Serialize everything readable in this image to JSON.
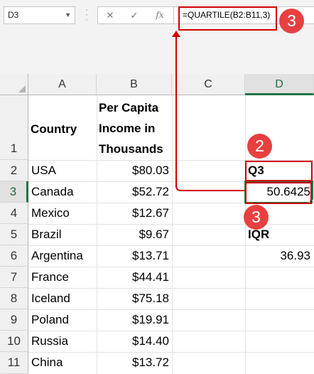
{
  "name_box": "D3",
  "formula_bar": {
    "cancel": "✕",
    "enter": "✓",
    "fx": "fx",
    "formula": "=QUARTILE(B2:B11,3)"
  },
  "columns": [
    "A",
    "B",
    "C",
    "D"
  ],
  "rows": [
    "1",
    "2",
    "3",
    "4",
    "5",
    "6",
    "7",
    "8",
    "9",
    "10",
    "11"
  ],
  "headers": {
    "country": "Country",
    "income_line1": "Per Capita",
    "income_line2": "Income in",
    "income_line3": "Thousands"
  },
  "data": [
    {
      "country": "USA",
      "income": "$80.03"
    },
    {
      "country": "Canada",
      "income": "$52.72"
    },
    {
      "country": "Mexico",
      "income": "$12.67"
    },
    {
      "country": "Brazil",
      "income": "$9.67"
    },
    {
      "country": "Argentina",
      "income": "$13.71"
    },
    {
      "country": "France",
      "income": "$44.41"
    },
    {
      "country": "Iceland",
      "income": "$75.18"
    },
    {
      "country": "Poland",
      "income": "$19.91"
    },
    {
      "country": "Russia",
      "income": "$14.40"
    },
    {
      "country": "China",
      "income": "$13.72"
    }
  ],
  "q3_label": "Q3",
  "q3_value": "50.6425",
  "iqr_label": "IQR",
  "iqr_value": "36.93",
  "annotations": {
    "badge_formula": "3",
    "badge_q3": "2",
    "badge_value": "3",
    "highlight_color": "#d00000",
    "badge_color": "#e84040"
  }
}
